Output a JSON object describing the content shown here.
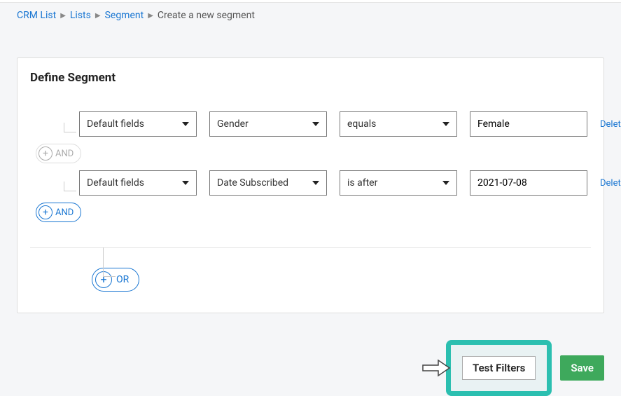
{
  "breadcrumb": {
    "items": [
      "CRM List",
      "Lists",
      "Segment"
    ],
    "current": "Create a new segment"
  },
  "card": {
    "title": "Define Segment"
  },
  "rules": [
    {
      "group": "Default fields",
      "field": "Gender",
      "op": "equals",
      "value": "Female",
      "delete": "Delete"
    },
    {
      "group": "Default fields",
      "field": "Date Subscribed",
      "op": "is after",
      "value": "2021-07-08",
      "delete": "Delete"
    }
  ],
  "joiners": {
    "and_disabled": "AND",
    "and_active": "AND",
    "or": "OR"
  },
  "actions": {
    "test": "Test Filters",
    "save": "Save"
  }
}
